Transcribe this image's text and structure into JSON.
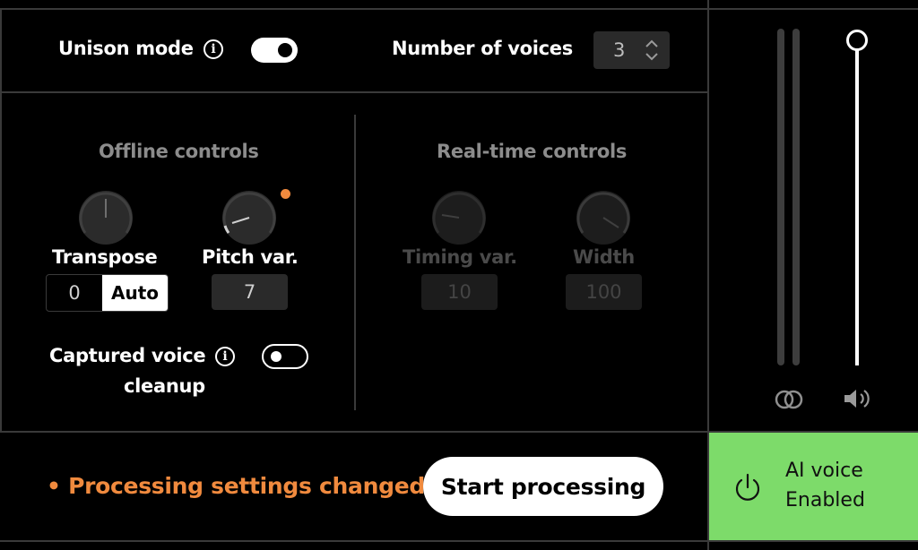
{
  "top": {
    "unison_label": "Unison mode",
    "unison_on": true,
    "voices_label": "Number of voices",
    "voices_value": "3"
  },
  "offline": {
    "title": "Offline controls",
    "transpose_label": "Transpose",
    "transpose_value": "0",
    "transpose_auto": "Auto",
    "pitch_label": "Pitch var.",
    "pitch_value": "7",
    "cleanup_label_1": "Captured voice",
    "cleanup_label_2": "cleanup",
    "cleanup_on": false
  },
  "realtime": {
    "title": "Real-time controls",
    "timing_label": "Timing var.",
    "timing_value": "10",
    "width_label": "Width",
    "width_value": "100"
  },
  "status": {
    "bullet": "•",
    "message": "Processing settings changed",
    "start_button": "Start processing"
  },
  "ai": {
    "line1": "AI voice",
    "line2": "Enabled"
  },
  "colors": {
    "accent_orange": "#f08a3e",
    "enabled_green": "#7ddb6a",
    "panel_line": "#3a3a3a"
  },
  "icons": {
    "info": "info-icon",
    "stereo": "stereo-link-icon",
    "volume": "speaker-icon",
    "power": "power-icon",
    "stepper": "chevron-up-down-icon"
  }
}
